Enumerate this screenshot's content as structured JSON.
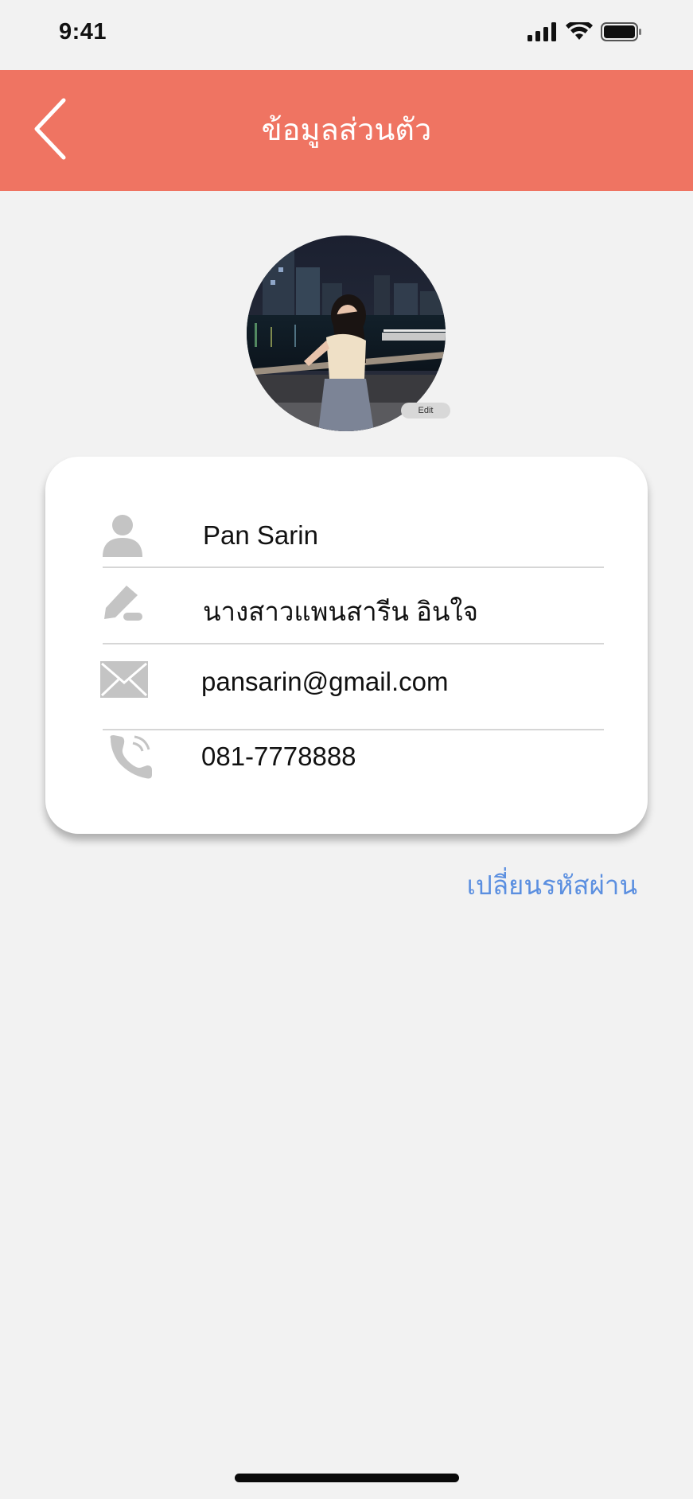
{
  "status_bar": {
    "time": "9:41",
    "icons": [
      "signal-icon",
      "wifi-icon",
      "battery-icon"
    ]
  },
  "header": {
    "title": "ข้อมูลส่วนตัว",
    "back_icon": "chevron-left-icon",
    "background_color": "#ef7462"
  },
  "profile": {
    "avatar_icon": "profile-photo",
    "edit_label": "Edit"
  },
  "card": {
    "name": "Pan  Sarin",
    "full_name": "นางสาวแพนสารีน อินใจ",
    "email": "pansarin@gmail.com",
    "phone": "081-7778888",
    "icons": [
      "person-icon",
      "pencil-icon",
      "envelope-icon",
      "phone-icon"
    ]
  },
  "actions": {
    "change_password": "เปลี่ยนรหัสผ่าน",
    "link_color": "#5b8fe0"
  }
}
